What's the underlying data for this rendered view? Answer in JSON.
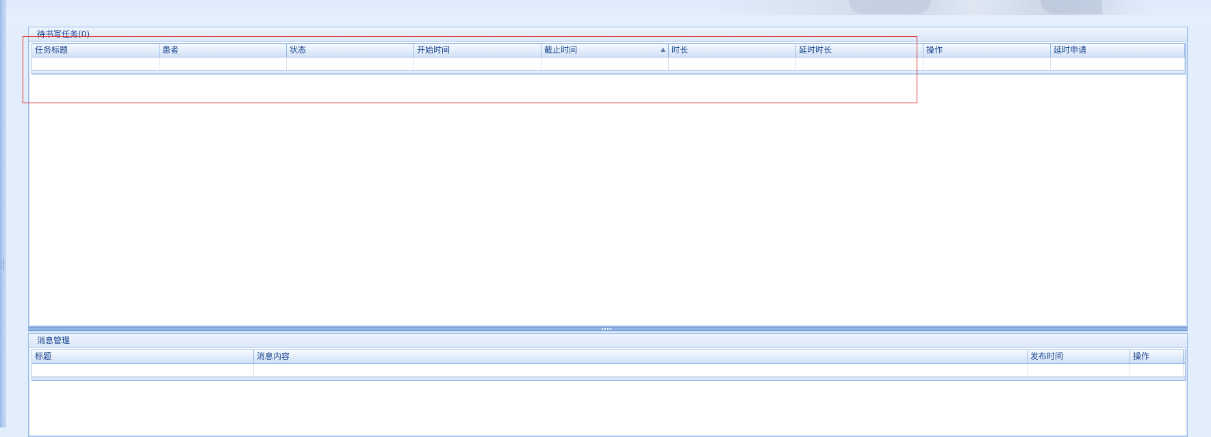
{
  "task_panel": {
    "title": "待书写任务(0)",
    "columns": [
      {
        "label": "任务标题",
        "width": 186
      },
      {
        "label": "患者",
        "width": 186
      },
      {
        "label": "状态",
        "width": 186
      },
      {
        "label": "开始时间",
        "width": 186
      },
      {
        "label": "截止时间",
        "width": 186,
        "sorted": "asc"
      },
      {
        "label": "时长",
        "width": 186
      },
      {
        "label": "延时时长",
        "width": 186
      },
      {
        "label": "操作",
        "width": 186
      },
      {
        "label": "延时申请",
        "width": 196
      }
    ],
    "rows": [
      [
        "",
        "",
        "",
        "",
        "",
        "",
        "",
        "",
        ""
      ]
    ],
    "sort_indicator": "▲"
  },
  "message_panel": {
    "title": "消息管理",
    "columns": [
      {
        "label": "标题",
        "width": 324
      },
      {
        "label": "消息内容",
        "width": 1130
      },
      {
        "label": "发布时间",
        "width": 150
      },
      {
        "label": "操作",
        "width": 78
      }
    ],
    "rows": [
      [
        "",
        "",
        "",
        ""
      ]
    ]
  },
  "colors": {
    "accent": "#15428b",
    "border": "#99bbe8",
    "highlight": "#e12a2a",
    "background": "#e3eefc"
  }
}
